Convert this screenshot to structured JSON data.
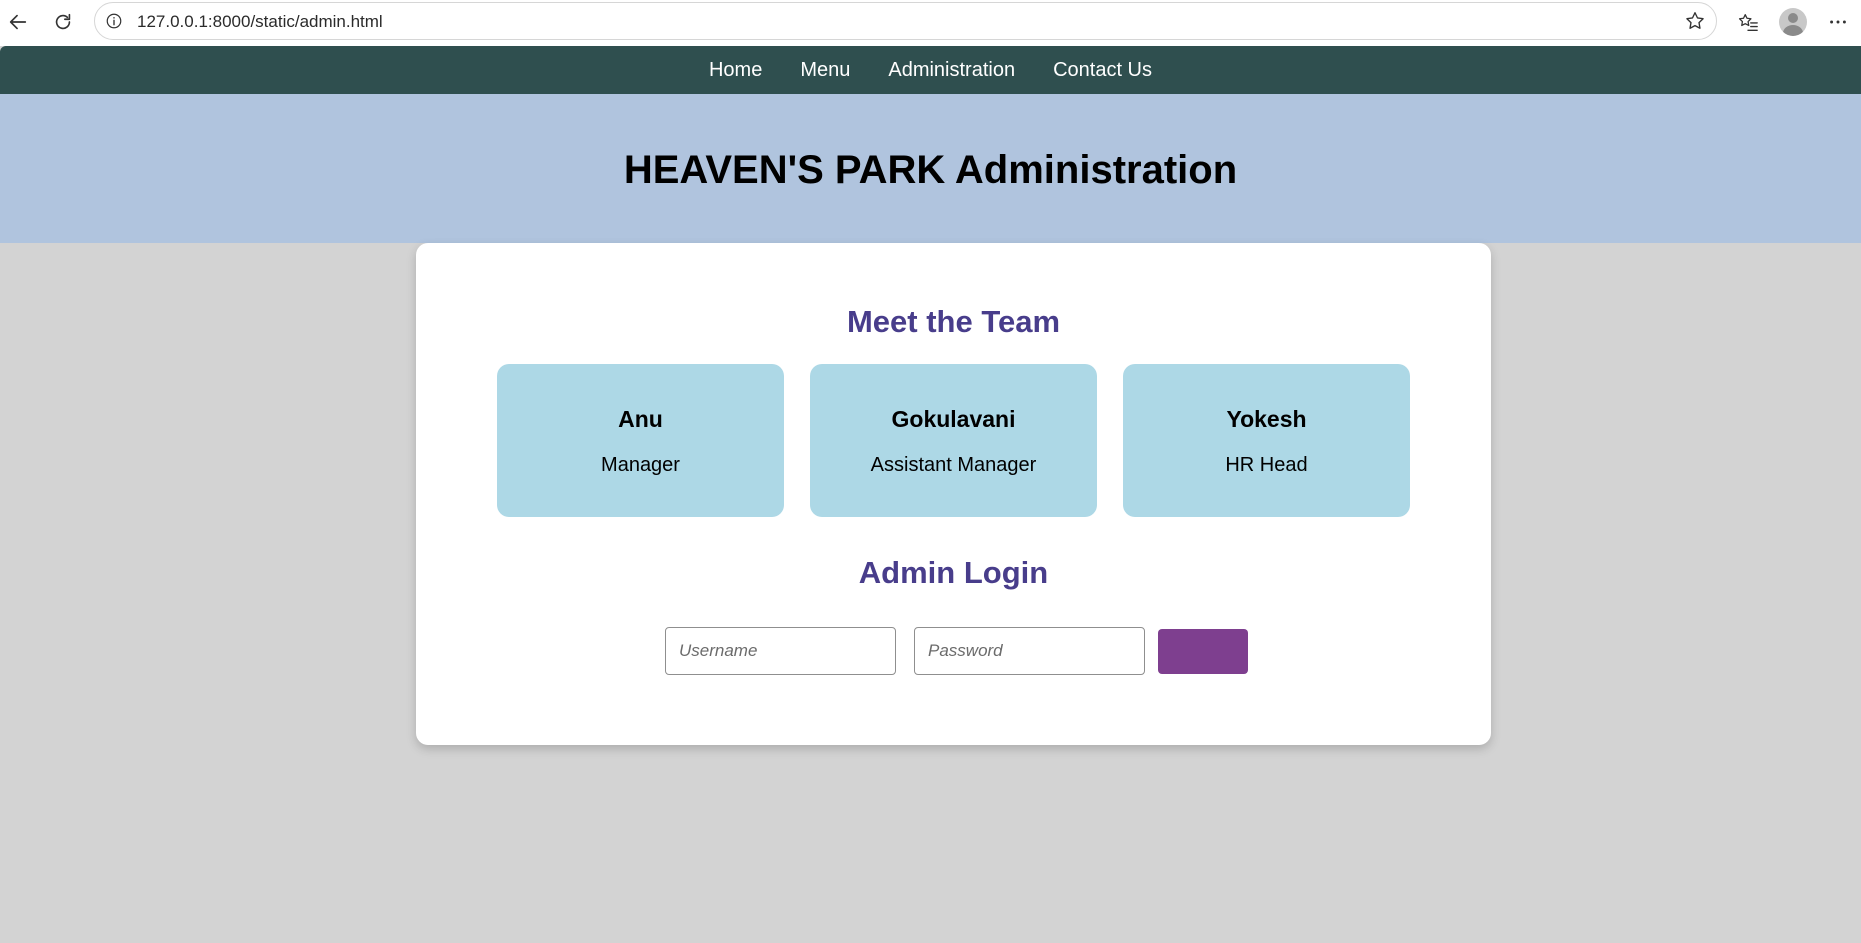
{
  "browser": {
    "url": "127.0.0.1:8000/static/admin.html"
  },
  "nav": {
    "items": [
      {
        "label": "Home"
      },
      {
        "label": "Menu"
      },
      {
        "label": "Administration"
      },
      {
        "label": "Contact Us"
      }
    ]
  },
  "header": {
    "title": "HEAVEN'S PARK Administration"
  },
  "team": {
    "title": "Meet the Team",
    "members": [
      {
        "name": "Anu",
        "role": "Manager"
      },
      {
        "name": "Gokulavani",
        "role": "Assistant Manager"
      },
      {
        "name": "Yokesh",
        "role": "HR Head"
      }
    ]
  },
  "login": {
    "title": "Admin Login",
    "username_placeholder": "Username",
    "password_placeholder": "Password",
    "button_label": ""
  },
  "colors": {
    "nav_bg": "#2f4f4f",
    "header_bg": "#b0c4de",
    "page_bg": "#d3d3d3",
    "card_bg": "#ffffff",
    "team_box_bg": "#add8e6",
    "section_title": "#483d8b",
    "button_bg": "#7e3f8f"
  },
  "icons": [
    "back-arrow-icon",
    "reload-icon",
    "info-icon",
    "star-icon",
    "favorites-icon",
    "profile-avatar-icon",
    "more-options-icon"
  ]
}
